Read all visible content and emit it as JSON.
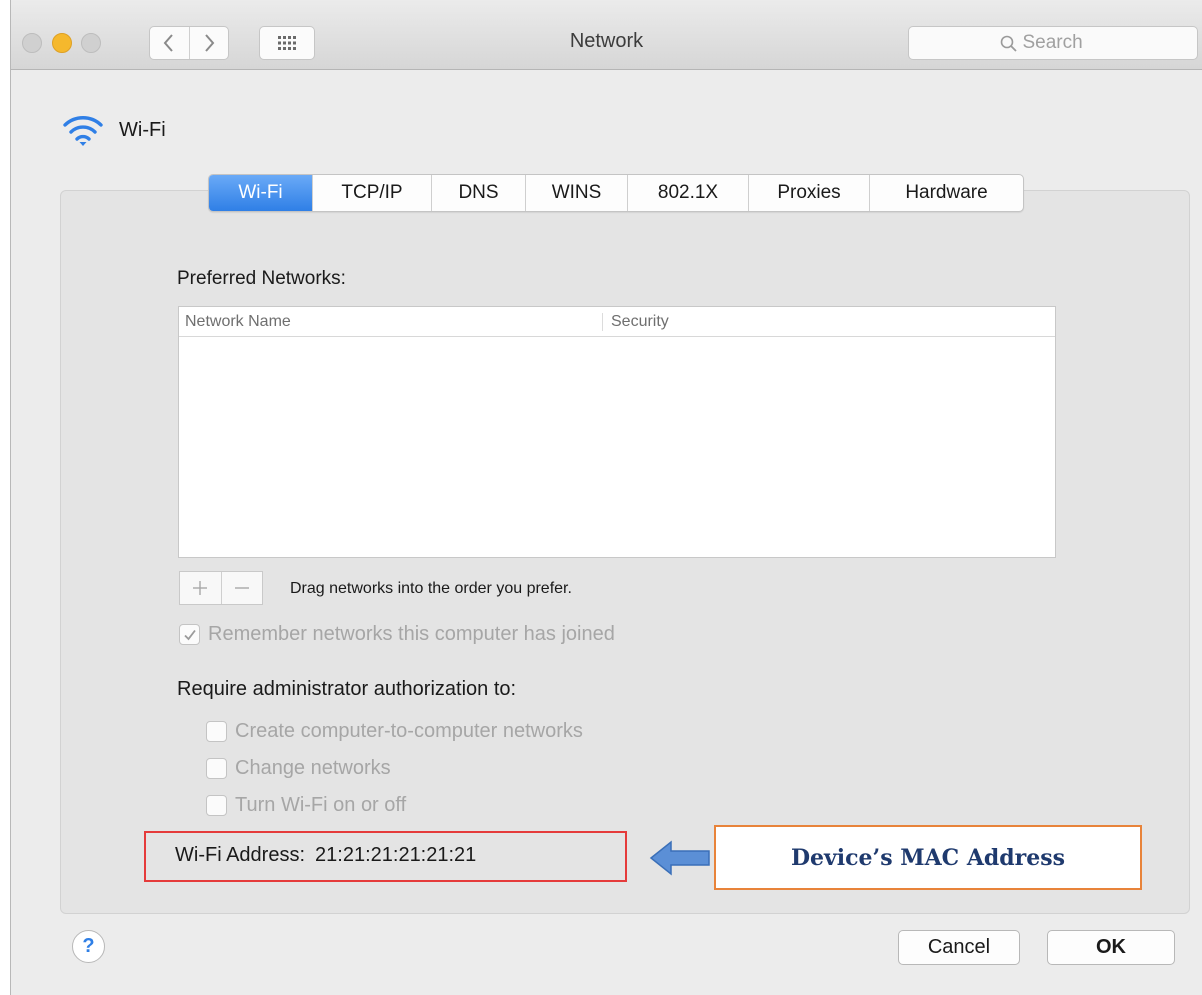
{
  "window": {
    "title": "Network",
    "search_placeholder": "Search"
  },
  "interface": {
    "name": "Wi-Fi",
    "icon": "wifi-icon",
    "accent_color": "#2f7fe6"
  },
  "tabs": [
    {
      "label": "Wi-Fi",
      "active": true
    },
    {
      "label": "TCP/IP",
      "active": false
    },
    {
      "label": "DNS",
      "active": false
    },
    {
      "label": "WINS",
      "active": false
    },
    {
      "label": "802.1X",
      "active": false
    },
    {
      "label": "Proxies",
      "active": false
    },
    {
      "label": "Hardware",
      "active": false
    }
  ],
  "preferred_networks": {
    "label": "Preferred Networks:",
    "columns": [
      "Network Name",
      "Security"
    ],
    "rows": [],
    "drag_hint": "Drag networks into the order you prefer."
  },
  "options": {
    "remember": {
      "label": "Remember networks this computer has joined",
      "checked": true
    },
    "require_label": "Require administrator authorization to:",
    "require_items": [
      {
        "label": "Create computer-to-computer networks",
        "checked": false
      },
      {
        "label": "Change networks",
        "checked": false
      },
      {
        "label": "Turn Wi-Fi on or off",
        "checked": false
      }
    ]
  },
  "address": {
    "label": "Wi-Fi Address:",
    "value": "21:21:21:21:21:21"
  },
  "annotation": {
    "text": "Device’s MAC Address",
    "highlight_color": "#e53b3b",
    "box_color": "#e8833a"
  },
  "footer": {
    "help": "?",
    "cancel": "Cancel",
    "ok": "OK"
  }
}
